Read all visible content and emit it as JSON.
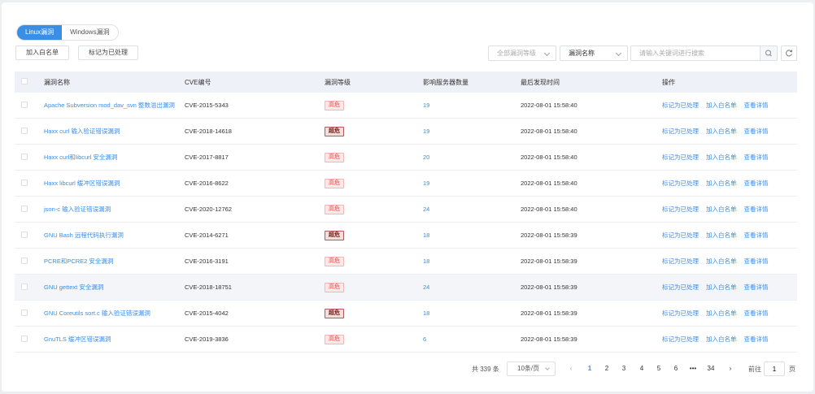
{
  "tabs": [
    {
      "label": "Linux漏洞",
      "active": true
    },
    {
      "label": "Windows漏洞",
      "active": false
    }
  ],
  "toolbar": {
    "whitelist_label": "加入白名单",
    "mark_done_label": "标记为已处理",
    "level_select": "全部漏洞等级",
    "field_select": "漏洞名称",
    "search_placeholder": "请输入关键词进行搜索"
  },
  "table": {
    "headers": {
      "name": "漏洞名称",
      "cve": "CVE编号",
      "level": "漏洞等级",
      "count": "影响服务器数量",
      "time": "最后发现时间",
      "ops": "操作"
    },
    "ops": {
      "mark": "标记为已处理",
      "whitelist": "加入白名单",
      "detail": "查看详情"
    },
    "rows": [
      {
        "name": "Apache Subversion mod_dav_svn 整数溢出漏洞",
        "cve": "CVE-2015-5343",
        "level": "高危",
        "severity": "high",
        "count": "19",
        "time": "2022-08-01 15:58:40"
      },
      {
        "name": "Haxx curl 输入验证错误漏洞",
        "cve": "CVE-2018-14618",
        "level": "超危",
        "severity": "critical",
        "count": "19",
        "time": "2022-08-01 15:58:40"
      },
      {
        "name": "Haxx curl和libcurl 安全漏洞",
        "cve": "CVE-2017-8817",
        "level": "高危",
        "severity": "high",
        "count": "20",
        "time": "2022-08-01 15:58:40"
      },
      {
        "name": "Haxx libcurl 缓冲区错误漏洞",
        "cve": "CVE-2016-8622",
        "level": "高危",
        "severity": "high",
        "count": "19",
        "time": "2022-08-01 15:58:40"
      },
      {
        "name": "json-c 输入验证错误漏洞",
        "cve": "CVE-2020-12762",
        "level": "高危",
        "severity": "high",
        "count": "24",
        "time": "2022-08-01 15:58:40"
      },
      {
        "name": "GNU Bash 远程代码执行漏洞",
        "cve": "CVE-2014-6271",
        "level": "超危",
        "severity": "critical",
        "count": "18",
        "time": "2022-08-01 15:58:39"
      },
      {
        "name": "PCRE和PCRE2 安全漏洞",
        "cve": "CVE-2016-3191",
        "level": "高危",
        "severity": "high",
        "count": "18",
        "time": "2022-08-01 15:58:39"
      },
      {
        "name": "GNU gettext 安全漏洞",
        "cve": "CVE-2018-18751",
        "level": "高危",
        "severity": "high",
        "count": "24",
        "time": "2022-08-01 15:58:39"
      },
      {
        "name": "GNU Coreutils sort.c 输入验证错误漏洞",
        "cve": "CVE-2015-4042",
        "level": "超危",
        "severity": "critical",
        "count": "18",
        "time": "2022-08-01 15:58:39"
      },
      {
        "name": "GnuTLS 缓冲区错误漏洞",
        "cve": "CVE-2019-3836",
        "level": "高危",
        "severity": "high",
        "count": "6",
        "time": "2022-08-01 15:58:39"
      }
    ]
  },
  "pagination": {
    "total": "共 339 条",
    "page_size": "10条/页",
    "pages": [
      "1",
      "2",
      "3",
      "4",
      "5",
      "6",
      "•••",
      "34"
    ],
    "current": "1",
    "goto_label": "前往",
    "goto_value": "1",
    "goto_suffix": "页"
  },
  "colors": {
    "accent": "#3a8ee6",
    "high": "#e84a4a",
    "critical": "#7a1a1a"
  }
}
